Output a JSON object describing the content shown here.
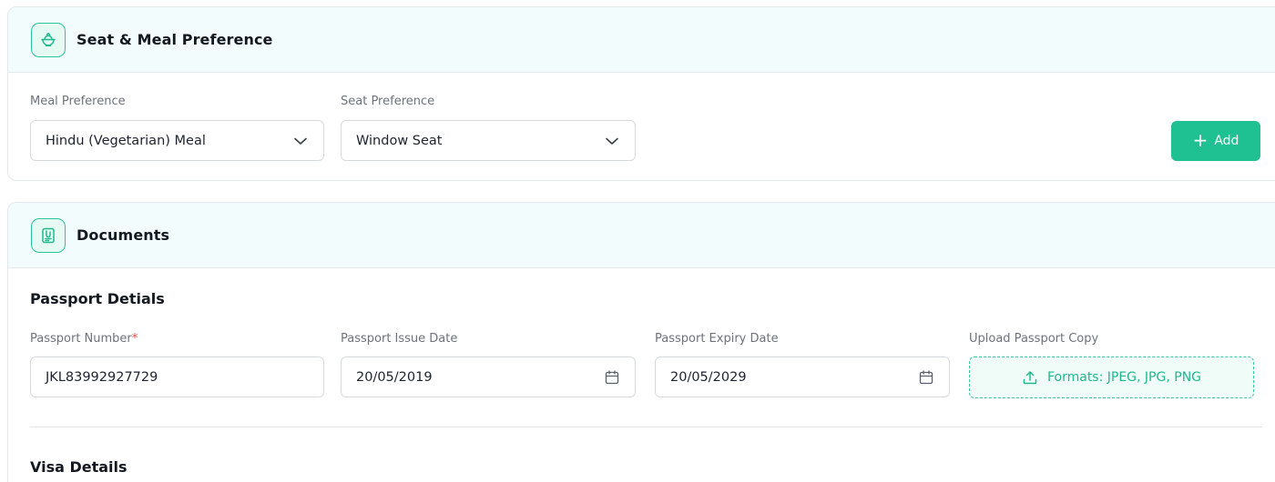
{
  "seat_meal": {
    "title": "Seat & Meal Preference",
    "icon": "meal-bowl-icon",
    "meal": {
      "label": "Meal Preference",
      "value": "Hindu (Vegetarian) Meal"
    },
    "seat": {
      "label": "Seat Preference",
      "value": "Window Seat"
    },
    "add_button": {
      "icon": "+",
      "label": "Add"
    }
  },
  "documents": {
    "title": "Documents",
    "icon": "document-clip-icon",
    "passport": {
      "heading": "Passport Detials",
      "number": {
        "label": "Passport Number",
        "required_mark": "*",
        "value": "JKL83992927729"
      },
      "issue_date": {
        "label": "Passport Issue Date",
        "value": "20/05/2019"
      },
      "expiry_date": {
        "label": "Passport Expiry Date",
        "value": "20/05/2029"
      },
      "upload": {
        "label": "Upload Passport Copy",
        "text": "Formats: JPEG, JPG, PNG"
      }
    },
    "visa": {
      "heading": "Visa Details"
    }
  },
  "colors": {
    "accent": "#1fc091",
    "header_bg": "#f3fcfc",
    "required": "#e8473c"
  }
}
